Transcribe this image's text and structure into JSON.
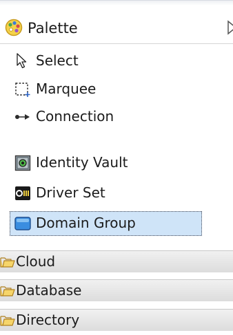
{
  "palette": {
    "title": "Palette",
    "header_icon": "palette-icon",
    "expand_icon": "triangle-right-icon"
  },
  "tools": [
    {
      "label": "Select",
      "icon": "pointer-arrow-icon"
    },
    {
      "label": "Marquee",
      "icon": "marquee-icon"
    },
    {
      "label": "Connection",
      "icon": "connection-icon"
    },
    {
      "label": "Identity Vault",
      "icon": "identity-vault-icon"
    },
    {
      "label": "Driver Set",
      "icon": "driver-set-icon"
    },
    {
      "label": "Domain Group",
      "icon": "domain-group-icon",
      "selected": true
    }
  ],
  "drawers": [
    {
      "label": "Cloud",
      "icon": "folder-icon"
    },
    {
      "label": "Database",
      "icon": "folder-icon"
    },
    {
      "label": "Directory",
      "icon": "folder-icon"
    }
  ],
  "colors": {
    "selected_background": "#cfe4f8",
    "drawer_background": "#e4e4e4",
    "folder": "#f2c44f"
  }
}
